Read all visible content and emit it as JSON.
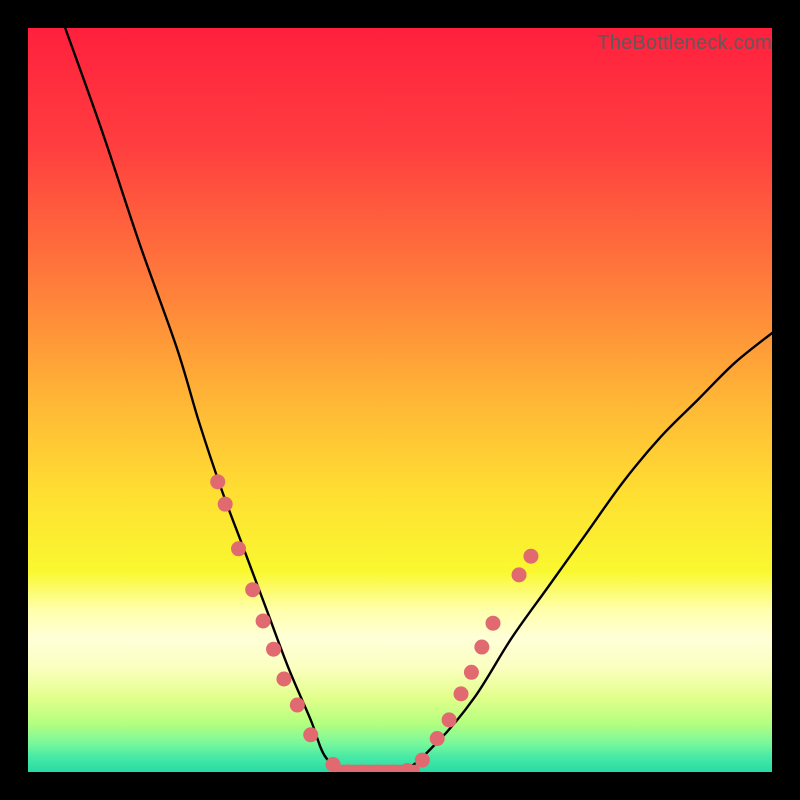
{
  "watermark": "TheBottleneck.com",
  "chart_data": {
    "type": "line",
    "title": "",
    "xlabel": "",
    "ylabel": "",
    "xlim": [
      0,
      100
    ],
    "ylim": [
      0,
      100
    ],
    "grid": false,
    "legend": false,
    "series": [
      {
        "name": "bottleneck-curve",
        "x": [
          5,
          10,
          15,
          20,
          23,
          26,
          29,
          32,
          35,
          38,
          40,
          43,
          50,
          55,
          60,
          65,
          70,
          75,
          80,
          85,
          90,
          95,
          100
        ],
        "y": [
          100,
          86,
          71,
          57,
          47,
          38,
          30,
          22,
          14,
          7,
          2,
          0,
          0,
          4,
          10,
          18,
          25,
          32,
          39,
          45,
          50,
          55,
          59
        ]
      }
    ],
    "dots": {
      "name": "highlight-dots",
      "color": "#e06a6f",
      "points": [
        {
          "x": 25.5,
          "y": 39
        },
        {
          "x": 26.5,
          "y": 36
        },
        {
          "x": 28.3,
          "y": 30
        },
        {
          "x": 30.2,
          "y": 24.5
        },
        {
          "x": 31.6,
          "y": 20.3
        },
        {
          "x": 33.0,
          "y": 16.5
        },
        {
          "x": 34.4,
          "y": 12.5
        },
        {
          "x": 36.2,
          "y": 9.0
        },
        {
          "x": 38.0,
          "y": 5.0
        },
        {
          "x": 41.0,
          "y": 1.0
        },
        {
          "x": 43.0,
          "y": 0.0
        },
        {
          "x": 45.0,
          "y": 0.0
        },
        {
          "x": 47.0,
          "y": 0.0
        },
        {
          "x": 49.0,
          "y": 0.0
        },
        {
          "x": 51.0,
          "y": 0.2
        },
        {
          "x": 53.0,
          "y": 1.6
        },
        {
          "x": 55.0,
          "y": 4.5
        },
        {
          "x": 56.6,
          "y": 7.0
        },
        {
          "x": 58.2,
          "y": 10.5
        },
        {
          "x": 59.6,
          "y": 13.4
        },
        {
          "x": 61.0,
          "y": 16.8
        },
        {
          "x": 62.5,
          "y": 20.0
        },
        {
          "x": 66.0,
          "y": 26.5
        },
        {
          "x": 67.6,
          "y": 29.0
        }
      ]
    },
    "gradient_bands": [
      {
        "stop": 0.0,
        "color": "#ff203e"
      },
      {
        "stop": 0.16,
        "color": "#ff3e3f"
      },
      {
        "stop": 0.34,
        "color": "#ff7b3b"
      },
      {
        "stop": 0.5,
        "color": "#ffb636"
      },
      {
        "stop": 0.63,
        "color": "#ffe032"
      },
      {
        "stop": 0.73,
        "color": "#f9f82f"
      },
      {
        "stop": 0.78,
        "color": "#ffffa8"
      },
      {
        "stop": 0.82,
        "color": "#ffffd8"
      },
      {
        "stop": 0.86,
        "color": "#fbffbf"
      },
      {
        "stop": 0.9,
        "color": "#e2ff8b"
      },
      {
        "stop": 0.935,
        "color": "#b3ff7f"
      },
      {
        "stop": 0.96,
        "color": "#7cf89a"
      },
      {
        "stop": 0.98,
        "color": "#48e9a6"
      },
      {
        "stop": 1.0,
        "color": "#27dba3"
      }
    ]
  }
}
